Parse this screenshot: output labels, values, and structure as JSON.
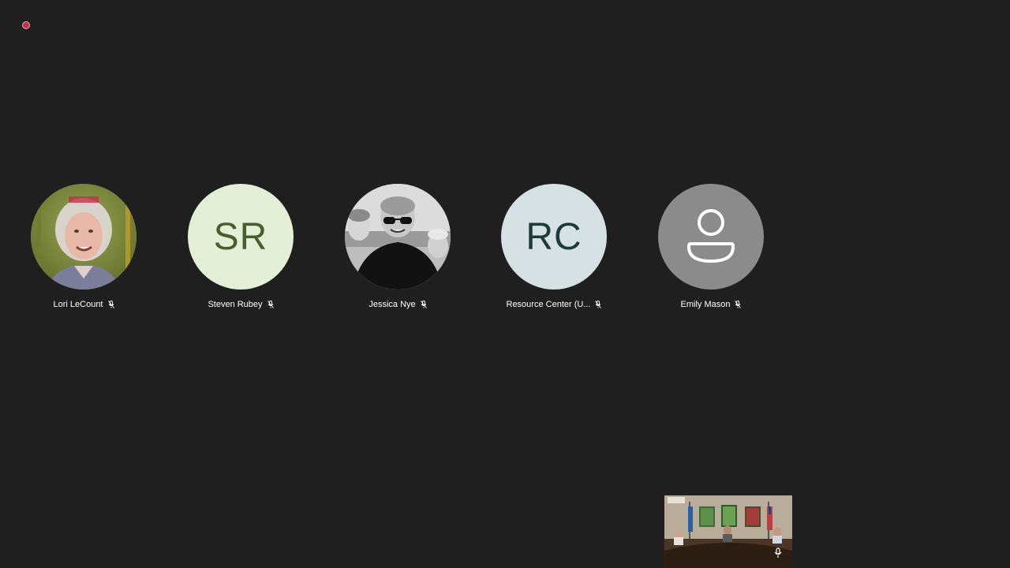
{
  "recording_indicator": {
    "color": "#c4314b"
  },
  "participants": [
    {
      "name": "Lori LeCount",
      "initials": "",
      "avatar_type": "photo",
      "avatar_bg": "#7d8a3a",
      "initials_color": "",
      "muted": true
    },
    {
      "name": "Steven Rubey",
      "initials": "SR",
      "avatar_type": "initials",
      "avatar_bg": "#e4efd8",
      "initials_color": "#4a5e2b",
      "muted": true
    },
    {
      "name": "Jessica Nye",
      "initials": "",
      "avatar_type": "photo",
      "avatar_bg": "#8c8c8c",
      "initials_color": "",
      "muted": true
    },
    {
      "name": "Resource Center (U...",
      "initials": "RC",
      "avatar_type": "initials",
      "avatar_bg": "#d6e1e3",
      "initials_color": "#1d3b3d",
      "muted": true
    },
    {
      "name": "Emily Mason",
      "initials": "",
      "avatar_type": "default-person-icon",
      "avatar_bg": "#8b8b8b",
      "initials_color": "",
      "muted": true
    }
  ],
  "self_view": {
    "icon": "microphone-icon"
  }
}
